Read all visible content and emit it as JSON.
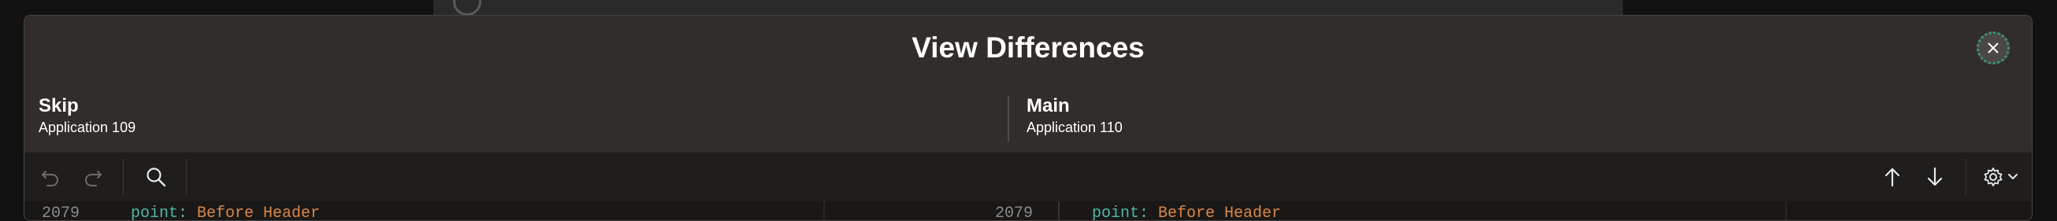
{
  "dialog": {
    "title": "View Differences",
    "close_label": "Close"
  },
  "left": {
    "name": "Skip",
    "app": "Application 109"
  },
  "right": {
    "name": "Main",
    "app": "Application 110"
  },
  "toolbar": {
    "undo_icon": "undo-icon",
    "redo_icon": "redo-icon",
    "search_icon": "search-icon",
    "prev_icon": "arrow-up-icon",
    "next_icon": "arrow-down-icon",
    "settings_icon": "gear-icon"
  },
  "code": {
    "left_lineno": "2079",
    "left_key": "point:",
    "left_value": "Before Header",
    "right_lineno": "2079",
    "right_key": "point:",
    "right_value": "Before Header"
  },
  "colors": {
    "dialog_bg": "#312d2a",
    "toolbar_bg": "#201e1c",
    "accent_green": "#3c9a6e",
    "code_key": "#4db8a6",
    "code_value": "#d9874a"
  }
}
